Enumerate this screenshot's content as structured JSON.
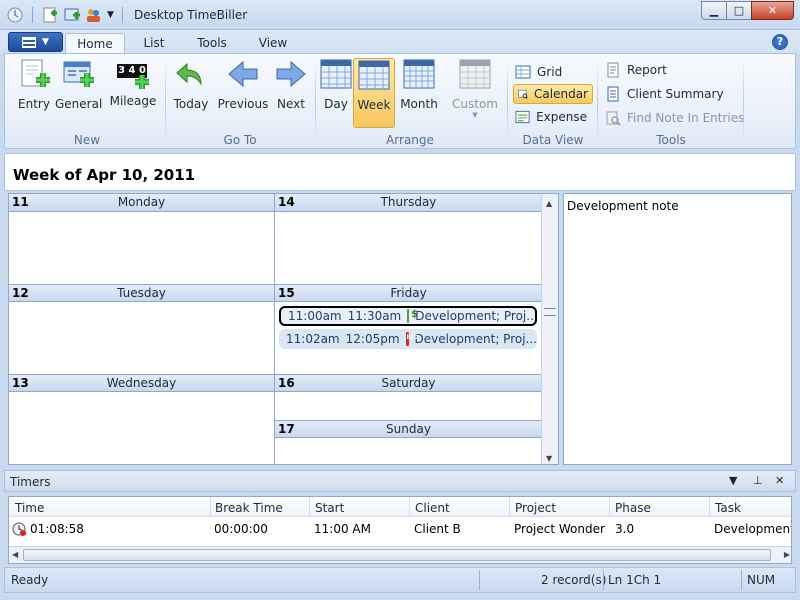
{
  "window": {
    "title": "Desktop TimeBiller"
  },
  "tabs": [
    {
      "label": "Home",
      "active": true
    },
    {
      "label": "List"
    },
    {
      "label": "Tools"
    },
    {
      "label": "View"
    }
  ],
  "help_glyph": "?",
  "ribbon": {
    "new": {
      "label": "New",
      "buttons": [
        "Entry",
        "General",
        "Mileage"
      ],
      "mileage_digits": "3 4 0"
    },
    "goto": {
      "label": "Go To",
      "buttons": [
        "Today",
        "Previous",
        "Next"
      ]
    },
    "arrange": {
      "label": "Arrange",
      "buttons": [
        "Day",
        "Week",
        "Month",
        "Custom"
      ],
      "active": "Week"
    },
    "dataview": {
      "label": "Data View",
      "buttons": [
        "Grid",
        "Calendar",
        "Expense"
      ],
      "active": "Calendar"
    },
    "tools": {
      "label": "Tools",
      "buttons": [
        "Report",
        "Client Summary",
        "Find Note In Entries"
      ]
    }
  },
  "week": {
    "title": "Week of Apr 10, 2011"
  },
  "days": [
    {
      "num": "11",
      "name": "Monday"
    },
    {
      "num": "12",
      "name": "Tuesday"
    },
    {
      "num": "13",
      "name": "Wednesday"
    },
    {
      "num": "14",
      "name": "Thursday"
    },
    {
      "num": "15",
      "name": "Friday"
    },
    {
      "num": "16",
      "name": "Saturday"
    },
    {
      "num": "17",
      "name": "Sunday"
    }
  ],
  "appointments": [
    {
      "start": "11:00am",
      "end": "11:30am",
      "text": "Development;  Proj...",
      "icon": "money-icon",
      "selected": true
    },
    {
      "start": "11:02am",
      "end": "12:05pm",
      "text": "Development;  Proj...",
      "icon": "stop-icon",
      "icon_text": "BID",
      "selected": false
    }
  ],
  "note": {
    "text": "Development note"
  },
  "timers": {
    "title": "Timers",
    "columns": [
      "Time",
      "Break Time",
      "Start",
      "Client",
      "Project",
      "Phase",
      "Task"
    ],
    "rows": [
      [
        "01:08:58",
        "00:00:00",
        "11:00 AM",
        "Client B",
        "Project Wonder",
        "3.0",
        "Development"
      ]
    ]
  },
  "status": {
    "ready": "Ready",
    "records": "2 record(s)",
    "position": "Ln 1Ch 1",
    "num": "NUM"
  },
  "colors": {
    "accent": "#1c4b9b",
    "active_button": "#f7c85e",
    "calendar_border": "#8ea9cc"
  }
}
